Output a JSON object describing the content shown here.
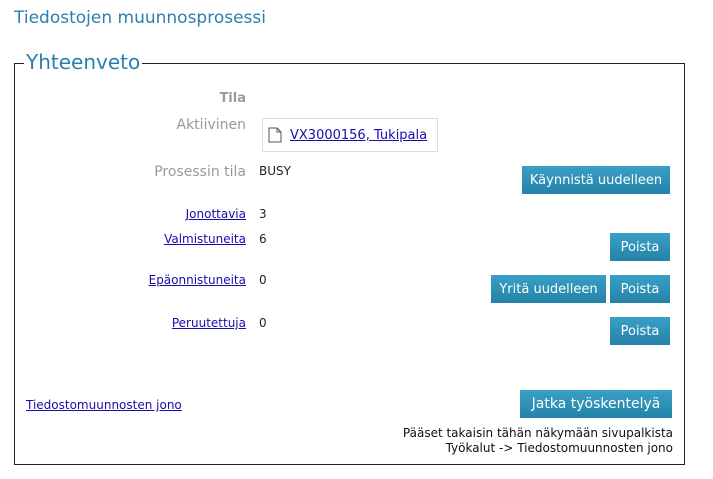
{
  "page_title": "Tiedostojen muunnosprosessi",
  "summary": {
    "legend": "Yhteenveto",
    "status_header": "Tila",
    "active_label": "Aktiivinen",
    "active_item": "VX3000156, Tukipala",
    "process_state_label": "Prosessin tila",
    "process_state_value": "BUSY",
    "restart_button": "Käynnistä uudelleen",
    "queued_label": "Jonottavia",
    "queued_count": "3",
    "completed_label": "Valmistuneita",
    "completed_count": "6",
    "failed_label": "Epäonnistuneita",
    "failed_count": "0",
    "cancelled_label": "Peruutettuja",
    "cancelled_count": "0",
    "delete_button": "Poista",
    "retry_button": "Yritä uudelleen"
  },
  "footer": {
    "queue_link": "Tiedostomuunnosten jono",
    "continue_button": "Jatka työskentelyä",
    "note_line1": "Pääset takaisin tähän näkymään sivupalkista",
    "note_line2": "Työkalut -> Tiedostomuunnosten jono"
  }
}
